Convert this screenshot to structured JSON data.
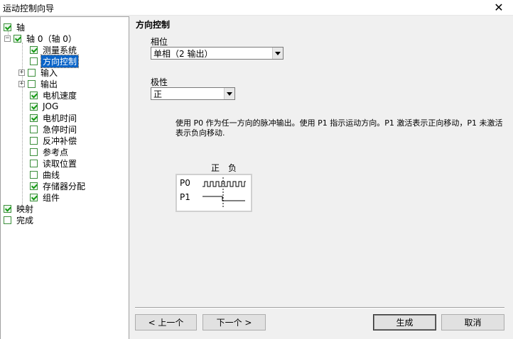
{
  "window": {
    "title": "运动控制向导",
    "close_glyph": "✕"
  },
  "tree": {
    "axis": "轴",
    "axis0": "轴 0（轴 0）",
    "items": [
      {
        "label": "测量系统",
        "checked": true
      },
      {
        "label": "方向控制",
        "checked": false,
        "selected": true
      },
      {
        "label": "输入",
        "checked": false,
        "expandable": true
      },
      {
        "label": "输出",
        "checked": false,
        "expandable": true
      },
      {
        "label": "电机速度",
        "checked": true
      },
      {
        "label": "JOG",
        "checked": true
      },
      {
        "label": "电机时间",
        "checked": true
      },
      {
        "label": "急停时间",
        "checked": false
      },
      {
        "label": "反冲补偿",
        "checked": false
      },
      {
        "label": "参考点",
        "checked": false
      },
      {
        "label": "读取位置",
        "checked": false
      },
      {
        "label": "曲线",
        "checked": false
      },
      {
        "label": "存储器分配",
        "checked": true
      },
      {
        "label": "组件",
        "checked": true
      }
    ],
    "mapping": "映射",
    "finish": "完成",
    "expand_glyph": "−",
    "collapse_glyph": "+"
  },
  "main": {
    "section_title": "方向控制",
    "phase_label": "相位",
    "phase_value": "单相（2 输出）",
    "polarity_label": "极性",
    "polarity_value": "正",
    "description": "使用 P0 作为任一方向的脉冲输出。使用 P1 指示运动方向。P1 激活表示正向移动，P1 未激活表示负向移动.",
    "diagram": {
      "pos_label": "正",
      "neg_label": "负",
      "p0": "P0",
      "p1": "P1"
    }
  },
  "buttons": {
    "prev": "< 上一个",
    "next": "下一个 >",
    "generate": "生成",
    "cancel": "取消"
  }
}
